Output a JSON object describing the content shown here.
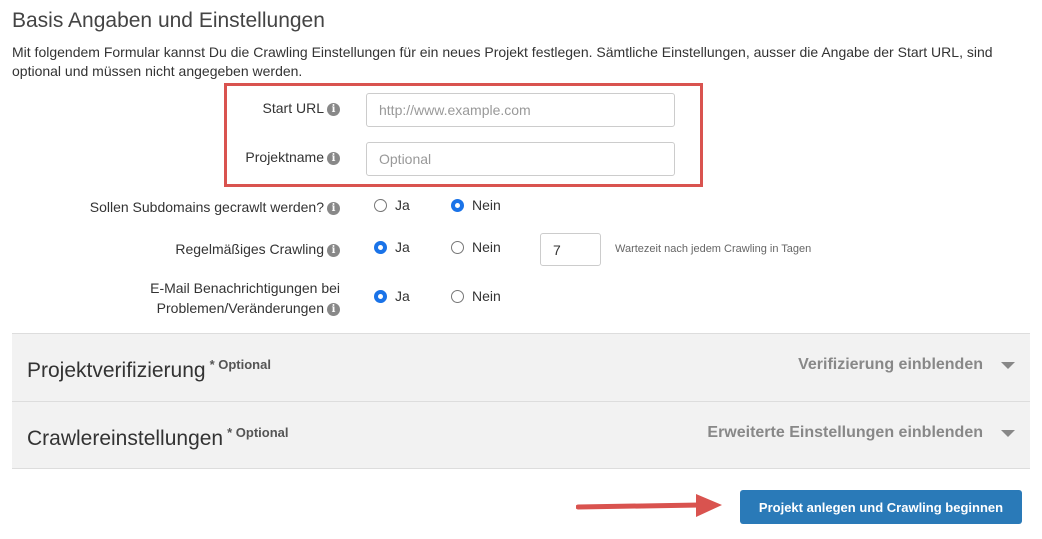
{
  "header": {
    "title": "Basis Angaben und Einstellungen",
    "intro": "Mit folgendem Formular kannst Du die Crawling Einstellungen für ein neues Projekt festlegen. Sämtliche Einstellungen, ausser die Angabe der Start URL, sind optional und müssen nicht angegeben werden."
  },
  "form": {
    "start_url": {
      "label": "Start URL",
      "placeholder": "http://www.example.com",
      "value": ""
    },
    "project_name": {
      "label": "Projektname",
      "placeholder": "Optional",
      "value": ""
    },
    "subdomains": {
      "label": "Sollen Subdomains gecrawlt werden?",
      "options": [
        "Ja",
        "Nein"
      ],
      "selected": "Nein"
    },
    "regular": {
      "label": "Regelmäßiges Crawling",
      "options": [
        "Ja",
        "Nein"
      ],
      "selected": "Ja",
      "days_value": "7",
      "days_hint": "Wartezeit nach jedem Crawling in Tagen"
    },
    "email": {
      "label_line1": "E-Mail Benachrichtigungen bei",
      "label_line2": "Problemen/Veränderungen",
      "options": [
        "Ja",
        "Nein"
      ],
      "selected": "Ja"
    }
  },
  "panels": {
    "verification": {
      "title": "Projektverifizierung",
      "optional": "* Optional",
      "toggle": "Verifizierung einblenden"
    },
    "crawler": {
      "title": "Crawlereinstellungen",
      "optional": "* Optional",
      "toggle": "Erweiterte Einstellungen einblenden"
    }
  },
  "actions": {
    "submit": "Projekt anlegen und Crawling beginnen"
  },
  "colors": {
    "accent": "#2a7ab8",
    "highlight": "#d9534f",
    "radio_checked": "#1a73e8"
  },
  "icons": {
    "info": "info-icon",
    "caret": "caret-down-icon",
    "annotation": "arrow-right-icon"
  }
}
